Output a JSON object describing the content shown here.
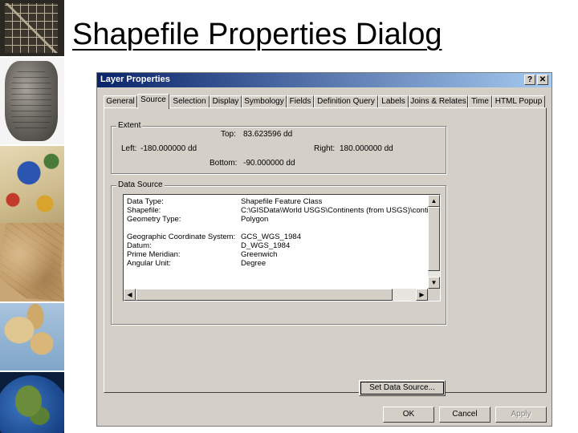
{
  "slide": {
    "title": "Shapefile Properties Dialog"
  },
  "dialog": {
    "title": "Layer Properties",
    "help_label": "?",
    "close_label": "✕",
    "tabs": [
      {
        "label": "General"
      },
      {
        "label": "Source",
        "active": true
      },
      {
        "label": "Selection"
      },
      {
        "label": "Display"
      },
      {
        "label": "Symbology"
      },
      {
        "label": "Fields"
      },
      {
        "label": "Definition Query"
      },
      {
        "label": "Labels"
      },
      {
        "label": "Joins & Relates"
      },
      {
        "label": "Time"
      },
      {
        "label": "HTML Popup"
      }
    ],
    "extent": {
      "label": "Extent",
      "top_label": "Top:",
      "top_value": "83.623596 dd",
      "left_label": "Left:",
      "left_value": "-180.000000 dd",
      "right_label": "Right:",
      "right_value": "180.000000 dd",
      "bottom_label": "Bottom:",
      "bottom_value": "-90.000000 dd"
    },
    "data_source": {
      "label": "Data Source",
      "rows": [
        {
          "key": "Data Type:",
          "value": "Shapefile Feature Class"
        },
        {
          "key": "Shapefile:",
          "value": "C:\\GISData\\World USGS\\Continents (from USGS)\\contin"
        },
        {
          "key": "Geometry Type:",
          "value": "Polygon"
        },
        {
          "key": "",
          "value": ""
        },
        {
          "key": "Geographic Coordinate System:",
          "value": "GCS_WGS_1984"
        },
        {
          "key": "Datum:",
          "value": "D_WGS_1984"
        },
        {
          "key": "Prime Meridian:",
          "value": "Greenwich"
        },
        {
          "key": "Angular Unit:",
          "value": "Degree"
        }
      ],
      "set_button": "Set Data Source..."
    },
    "buttons": {
      "ok": "OK",
      "cancel": "Cancel",
      "apply": "Apply"
    }
  }
}
